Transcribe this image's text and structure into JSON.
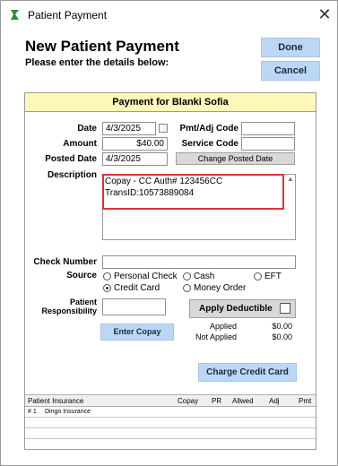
{
  "window": {
    "title": "Patient Payment",
    "close_glyph": "✕",
    "icon_color": "#2e8b3a"
  },
  "header": {
    "title": "New Patient Payment",
    "subtitle": "Please enter the details below:",
    "done_label": "Done",
    "cancel_label": "Cancel"
  },
  "panel": {
    "title": "Payment for Blanki Sofia",
    "date_label": "Date",
    "date_value": "4/3/2025",
    "amount_label": "Amount",
    "amount_value": "$40.00",
    "posted_date_label": "Posted Date",
    "posted_date_value": "4/3/2025",
    "pmt_adj_label": "Pmt/Adj Code",
    "pmt_adj_value": "",
    "service_code_label": "Service Code",
    "service_code_value": "",
    "change_posted_date_label": "Change Posted Date",
    "description_label": "Description",
    "description_value": "Copay - CC Auth# 123456CC\nTransID:10573889084",
    "check_number_label": "Check Number",
    "check_number_value": "",
    "source_label": "Source",
    "source_options": {
      "personal_check": "Personal Check",
      "cash": "Cash",
      "eft": "EFT",
      "credit_card": "Credit Card",
      "money_order": "Money Order"
    },
    "source_selected": "Credit Card",
    "patient_resp_label": "Patient\nResponsibility",
    "patient_resp_value": "",
    "apply_deductible_label": "Apply Deductible",
    "applied_label": "Applied",
    "applied_value": "$0.00",
    "not_applied_label": "Not Applied",
    "not_applied_value": "$0.00",
    "enter_copay_label": "Enter Copay",
    "charge_cc_label": "Charge Credit Card"
  },
  "insurance": {
    "columns": [
      "Patient Insurance",
      "Copay",
      "PR",
      "Allwed",
      "Adj",
      "Pmt"
    ],
    "rows": [
      {
        "num": "# 1",
        "name": "Dingo Insurance"
      }
    ]
  }
}
